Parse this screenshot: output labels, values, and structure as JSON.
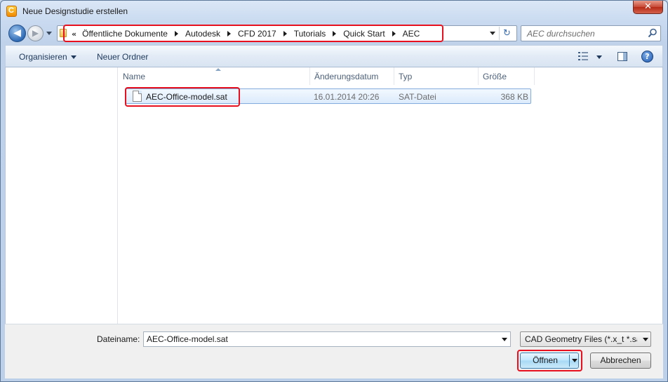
{
  "window": {
    "title": "Neue Designstudie erstellen",
    "app_icon_letter": "C",
    "close_glyph": "✕"
  },
  "nav": {
    "back_glyph": "◀",
    "forward_glyph": "▶",
    "breadcrumb_overflow": "«",
    "breadcrumbs": [
      "Öffentliche Dokumente",
      "Autodesk",
      "CFD 2017",
      "Tutorials",
      "Quick Start",
      "AEC"
    ],
    "refresh_glyph": "↻",
    "search_placeholder": "AEC durchsuchen"
  },
  "toolbar": {
    "organize_label": "Organisieren",
    "new_folder_label": "Neuer Ordner",
    "help_glyph": "?"
  },
  "file_list": {
    "columns": [
      "Name",
      "Änderungsdatum",
      "Typ",
      "Größe"
    ],
    "rows": [
      {
        "name": "AEC-Office-model.sat",
        "date": "16.01.2014 20:26",
        "type": "SAT-Datei",
        "size": "368 KB"
      }
    ]
  },
  "bottom": {
    "filename_label": "Dateiname:",
    "filename_value": "AEC-Office-model.sat",
    "filter_value": "CAD Geometry Files (*.x_t *.sat *",
    "open_label": "Öffnen",
    "cancel_label": "Abbrechen"
  },
  "colors": {
    "highlight": "#e8101e",
    "selection": "#dcebfc",
    "frame": "#bcd0e9"
  }
}
